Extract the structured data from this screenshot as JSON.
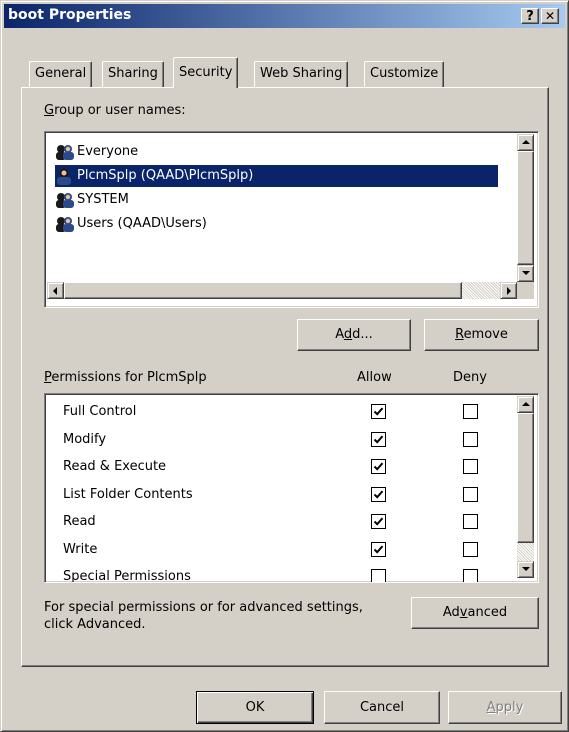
{
  "window": {
    "title": "boot Properties",
    "help_label": "?",
    "close_label": "✕"
  },
  "tabs": [
    {
      "label": "General"
    },
    {
      "label": "Sharing"
    },
    {
      "label": "Security"
    },
    {
      "label": "Web Sharing"
    },
    {
      "label": "Customize"
    }
  ],
  "active_tab": "Security",
  "groups": {
    "label_accel": "G",
    "label_rest": "roup or user names:",
    "items": [
      {
        "name": "Everyone",
        "selected": false,
        "icon": "group-icon"
      },
      {
        "name": "PlcmSplp (QAAD\\PlcmSplp)",
        "selected": true,
        "icon": "user-icon"
      },
      {
        "name": "SYSTEM",
        "selected": false,
        "icon": "group-icon"
      },
      {
        "name": "Users (QAAD\\Users)",
        "selected": false,
        "icon": "group-icon"
      }
    ]
  },
  "buttons": {
    "add_pre": "A",
    "add_accel": "d",
    "add_post": "d...",
    "remove_accel": "R",
    "remove_rest": "emove",
    "advanced_pre": "Ad",
    "advanced_accel": "v",
    "advanced_post": "anced",
    "ok": "OK",
    "cancel": "Cancel",
    "apply_accel": "A",
    "apply_rest": "pply"
  },
  "permissions": {
    "label_accel": "P",
    "label_rest": "ermissions for PlcmSplp",
    "allow_header": "Allow",
    "deny_header": "Deny",
    "rows": [
      {
        "name": "Full Control",
        "allow": true,
        "deny": false
      },
      {
        "name": "Modify",
        "allow": true,
        "deny": false
      },
      {
        "name": "Read & Execute",
        "allow": true,
        "deny": false
      },
      {
        "name": "List Folder Contents",
        "allow": true,
        "deny": false
      },
      {
        "name": "Read",
        "allow": true,
        "deny": false
      },
      {
        "name": "Write",
        "allow": true,
        "deny": false
      },
      {
        "name": "Special Permissions",
        "allow": false,
        "deny": false
      }
    ]
  },
  "advanced_text": {
    "line1": "For special permissions or for advanced settings,",
    "line2": "click Advanced."
  },
  "colors": {
    "titlebar_start": "#0a246a",
    "titlebar_end": "#a6caf0",
    "selection": "#0a246a",
    "face": "#d4d0c8"
  }
}
